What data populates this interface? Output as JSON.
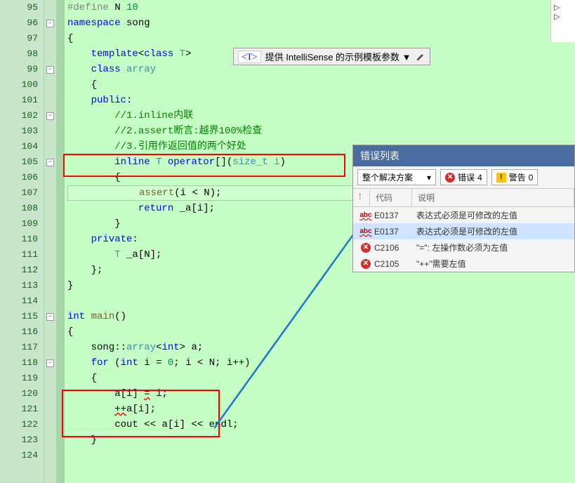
{
  "lines": [
    {
      "n": 95,
      "fold": "",
      "tokens": [
        [
          "pre",
          "#define"
        ],
        [
          "op",
          " "
        ],
        [
          "var",
          "N"
        ],
        [
          "op",
          " "
        ],
        [
          "num",
          "10"
        ]
      ]
    },
    {
      "n": 96,
      "fold": "-",
      "tokens": [
        [
          "kw",
          "namespace"
        ],
        [
          "op",
          " "
        ],
        [
          "var",
          "song"
        ]
      ]
    },
    {
      "n": 97,
      "fold": "",
      "tokens": [
        [
          "op",
          "{"
        ]
      ]
    },
    {
      "n": 98,
      "fold": "",
      "tokens": [
        [
          "op",
          "    "
        ],
        [
          "kw",
          "template"
        ],
        [
          "op",
          "<"
        ],
        [
          "kw",
          "class"
        ],
        [
          "op",
          " "
        ],
        [
          "cls",
          "T"
        ],
        [
          "op",
          ">"
        ]
      ]
    },
    {
      "n": 99,
      "fold": "-",
      "tokens": [
        [
          "op",
          "    "
        ],
        [
          "kw",
          "class"
        ],
        [
          "op",
          " "
        ],
        [
          "cls",
          "array"
        ]
      ]
    },
    {
      "n": 100,
      "fold": "",
      "tokens": [
        [
          "op",
          "    {"
        ]
      ]
    },
    {
      "n": 101,
      "fold": "",
      "tokens": [
        [
          "op",
          "    "
        ],
        [
          "kw",
          "public"
        ],
        [
          "op",
          ":"
        ]
      ]
    },
    {
      "n": 102,
      "fold": "-",
      "tokens": [
        [
          "op",
          "        "
        ],
        [
          "cmt",
          "//1.inline内联"
        ]
      ]
    },
    {
      "n": 103,
      "fold": "",
      "tokens": [
        [
          "op",
          "        "
        ],
        [
          "cmt",
          "//2.assert断言:越界100%检查"
        ]
      ]
    },
    {
      "n": 104,
      "fold": "",
      "tokens": [
        [
          "op",
          "        "
        ],
        [
          "cmt",
          "//3.引用作返回值的两个好处"
        ]
      ]
    },
    {
      "n": 105,
      "fold": "-",
      "tokens": [
        [
          "op",
          "        "
        ],
        [
          "kw",
          "inline"
        ],
        [
          "op",
          " "
        ],
        [
          "cls",
          "T"
        ],
        [
          "op",
          " "
        ],
        [
          "kw",
          "operator"
        ],
        [
          "op",
          "[]("
        ],
        [
          "cls",
          "size_t"
        ],
        [
          "op",
          " "
        ],
        [
          "param",
          "i"
        ],
        [
          "op",
          ")"
        ]
      ]
    },
    {
      "n": 106,
      "fold": "",
      "tokens": [
        [
          "op",
          "        {"
        ]
      ]
    },
    {
      "n": 107,
      "fold": "",
      "hl": true,
      "tokens": [
        [
          "op",
          "            "
        ],
        [
          "func",
          "assert"
        ],
        [
          "op",
          "("
        ],
        [
          "var",
          "i"
        ],
        [
          "op",
          " < "
        ],
        [
          "var",
          "N"
        ],
        [
          "op",
          ");"
        ]
      ]
    },
    {
      "n": 108,
      "fold": "",
      "tokens": [
        [
          "op",
          "            "
        ],
        [
          "kw",
          "return"
        ],
        [
          "op",
          " "
        ],
        [
          "var",
          "_a"
        ],
        [
          "op",
          "["
        ],
        [
          "var",
          "i"
        ],
        [
          "op",
          "];"
        ]
      ]
    },
    {
      "n": 109,
      "fold": "",
      "tokens": [
        [
          "op",
          "        }"
        ]
      ]
    },
    {
      "n": 110,
      "fold": "",
      "tokens": [
        [
          "op",
          "    "
        ],
        [
          "kw",
          "private"
        ],
        [
          "op",
          ":"
        ]
      ]
    },
    {
      "n": 111,
      "fold": "",
      "tokens": [
        [
          "op",
          "        "
        ],
        [
          "cls",
          "T"
        ],
        [
          "op",
          " "
        ],
        [
          "var",
          "_a"
        ],
        [
          "op",
          "["
        ],
        [
          "var",
          "N"
        ],
        [
          "op",
          "];"
        ]
      ]
    },
    {
      "n": 112,
      "fold": "",
      "tokens": [
        [
          "op",
          "    };"
        ]
      ]
    },
    {
      "n": 113,
      "fold": "",
      "tokens": [
        [
          "op",
          "}"
        ]
      ]
    },
    {
      "n": 114,
      "fold": "",
      "tokens": [
        [
          "op",
          ""
        ]
      ]
    },
    {
      "n": 115,
      "fold": "-",
      "tokens": [
        [
          "kw",
          "int"
        ],
        [
          "op",
          " "
        ],
        [
          "func",
          "main"
        ],
        [
          "op",
          "()"
        ]
      ]
    },
    {
      "n": 116,
      "fold": "",
      "tokens": [
        [
          "op",
          "{"
        ]
      ]
    },
    {
      "n": 117,
      "fold": "",
      "tokens": [
        [
          "op",
          "    "
        ],
        [
          "var",
          "song"
        ],
        [
          "op",
          "::"
        ],
        [
          "cls",
          "array"
        ],
        [
          "op",
          "<"
        ],
        [
          "kw",
          "int"
        ],
        [
          "op",
          "> "
        ],
        [
          "var",
          "a"
        ],
        [
          "op",
          ";"
        ]
      ]
    },
    {
      "n": 118,
      "fold": "-",
      "tokens": [
        [
          "op",
          "    "
        ],
        [
          "kw",
          "for"
        ],
        [
          "op",
          " ("
        ],
        [
          "kw",
          "int"
        ],
        [
          "op",
          " "
        ],
        [
          "var",
          "i"
        ],
        [
          "op",
          " = "
        ],
        [
          "num",
          "0"
        ],
        [
          "op",
          "; "
        ],
        [
          "var",
          "i"
        ],
        [
          "op",
          " < "
        ],
        [
          "var",
          "N"
        ],
        [
          "op",
          "; "
        ],
        [
          "var",
          "i"
        ],
        [
          "op",
          "++)"
        ]
      ]
    },
    {
      "n": 119,
      "fold": "",
      "tokens": [
        [
          "op",
          "    {"
        ]
      ]
    },
    {
      "n": 120,
      "fold": "",
      "tokens": [
        [
          "op",
          "        "
        ],
        [
          "var",
          "a"
        ],
        [
          "op",
          "["
        ],
        [
          "var",
          "i"
        ],
        [
          "op",
          "] "
        ],
        [
          "err",
          "="
        ],
        [
          "op",
          " "
        ],
        [
          "var",
          "i"
        ],
        [
          "op",
          ";"
        ]
      ]
    },
    {
      "n": 121,
      "fold": "",
      "tokens": [
        [
          "op",
          "        "
        ],
        [
          "err",
          "++"
        ],
        [
          "var",
          "a"
        ],
        [
          "op",
          "["
        ],
        [
          "var",
          "i"
        ],
        [
          "op",
          "];"
        ]
      ]
    },
    {
      "n": 122,
      "fold": "",
      "tokens": [
        [
          "op",
          "        "
        ],
        [
          "var",
          "cout"
        ],
        [
          "op",
          " << "
        ],
        [
          "var",
          "a"
        ],
        [
          "op",
          "["
        ],
        [
          "var",
          "i"
        ],
        [
          "op",
          "] << "
        ],
        [
          "var",
          "endl"
        ],
        [
          "op",
          ";"
        ]
      ]
    },
    {
      "n": 123,
      "fold": "",
      "tokens": [
        [
          "op",
          "    }"
        ]
      ]
    },
    {
      "n": 124,
      "fold": "",
      "tokens": [
        [
          "op",
          ""
        ]
      ]
    }
  ],
  "hint": {
    "tag": "<T>",
    "text": "提供 IntelliSense 的示例模板参数 ▼"
  },
  "error_panel": {
    "title": "错误列表",
    "combo": "整个解决方案",
    "err_btn": {
      "label": "错误",
      "count": 4
    },
    "warn_btn": {
      "label": "警告",
      "count": 0
    },
    "headers": {
      "code": "代码",
      "desc": "说明"
    },
    "rows": [
      {
        "icon": "abc",
        "code": "E0137",
        "desc": "表达式必须是可修改的左值",
        "hl": false
      },
      {
        "icon": "abc",
        "code": "E0137",
        "desc": "表达式必须是可修改的左值",
        "hl": true
      },
      {
        "icon": "err",
        "code": "C2106",
        "desc": "\"=\": 左操作数必须为左值",
        "hl": false
      },
      {
        "icon": "err",
        "code": "C2105",
        "desc": "\"++\"需要左值",
        "hl": false
      }
    ]
  },
  "toc_items": [
    "▷",
    "▷"
  ]
}
